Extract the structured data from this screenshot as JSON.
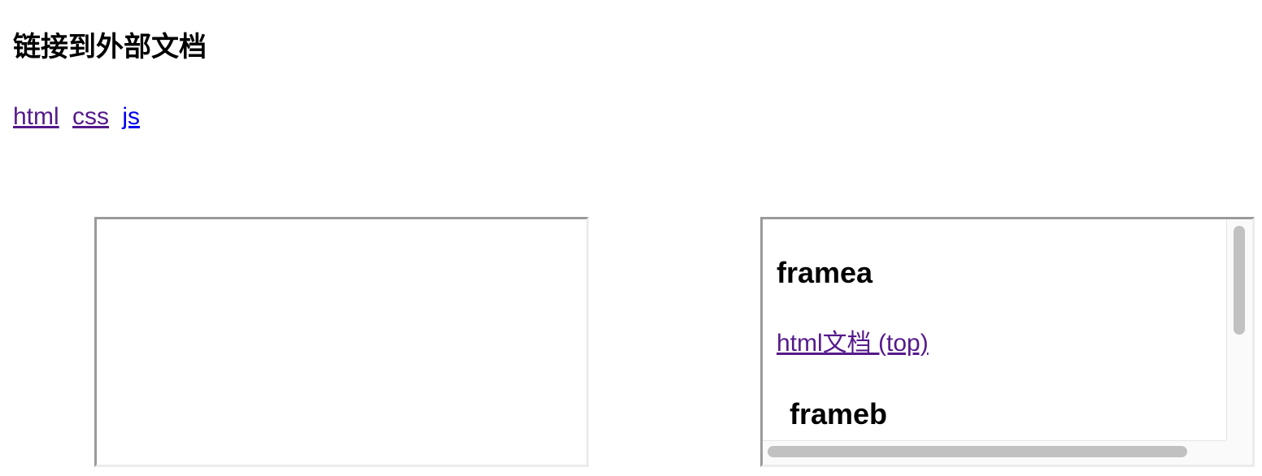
{
  "heading": "链接到外部文档",
  "links": [
    {
      "label": "html",
      "state": "visited"
    },
    {
      "label": "css",
      "state": "visited"
    },
    {
      "label": "js",
      "state": "unvisited"
    }
  ],
  "colors": {
    "visited_link": "#551a8b",
    "unvisited_link": "#0000ee",
    "scrollbar_thumb": "#c1c1c1"
  },
  "iframe_right": {
    "title_a": "framea",
    "link": "html文档 (top)",
    "title_b": "frameb"
  }
}
